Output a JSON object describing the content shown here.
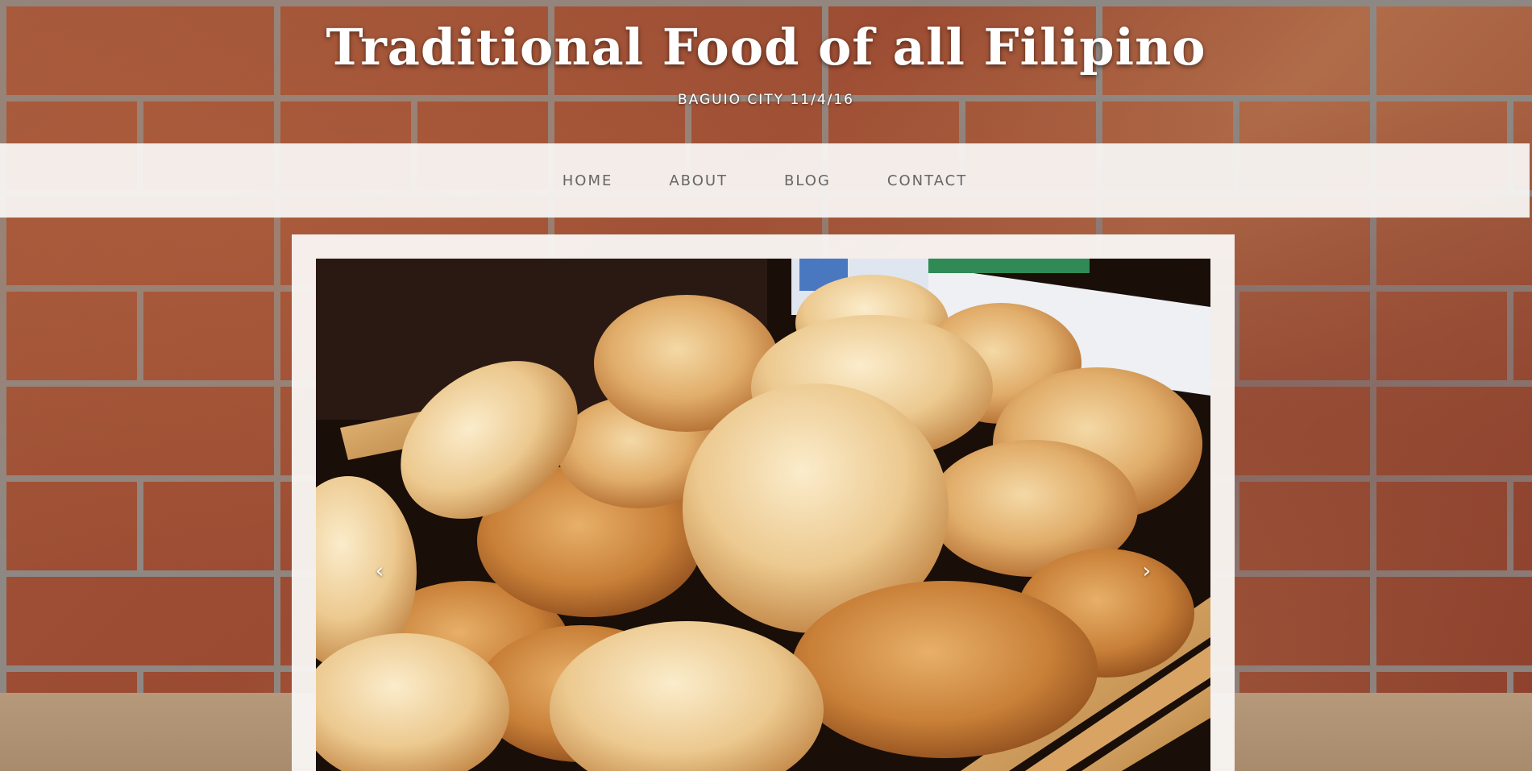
{
  "header": {
    "title": "Traditional Food of all Filipino",
    "tagline": "BAGUIO CITY 11/4/16"
  },
  "nav": {
    "items": [
      {
        "label": "HOME"
      },
      {
        "label": "ABOUT"
      },
      {
        "label": "BLOG"
      },
      {
        "label": "CONTACT"
      }
    ]
  },
  "slider": {
    "prev_glyph": "‹",
    "next_glyph": "›",
    "photo_icon": "bread-rolls-photo"
  },
  "colors": {
    "nav_bg": "#f8f5f3",
    "nav_text": "#666666",
    "title_text": "#ffffff",
    "brick": "#9a4a31",
    "mortar": "#8e8884"
  }
}
